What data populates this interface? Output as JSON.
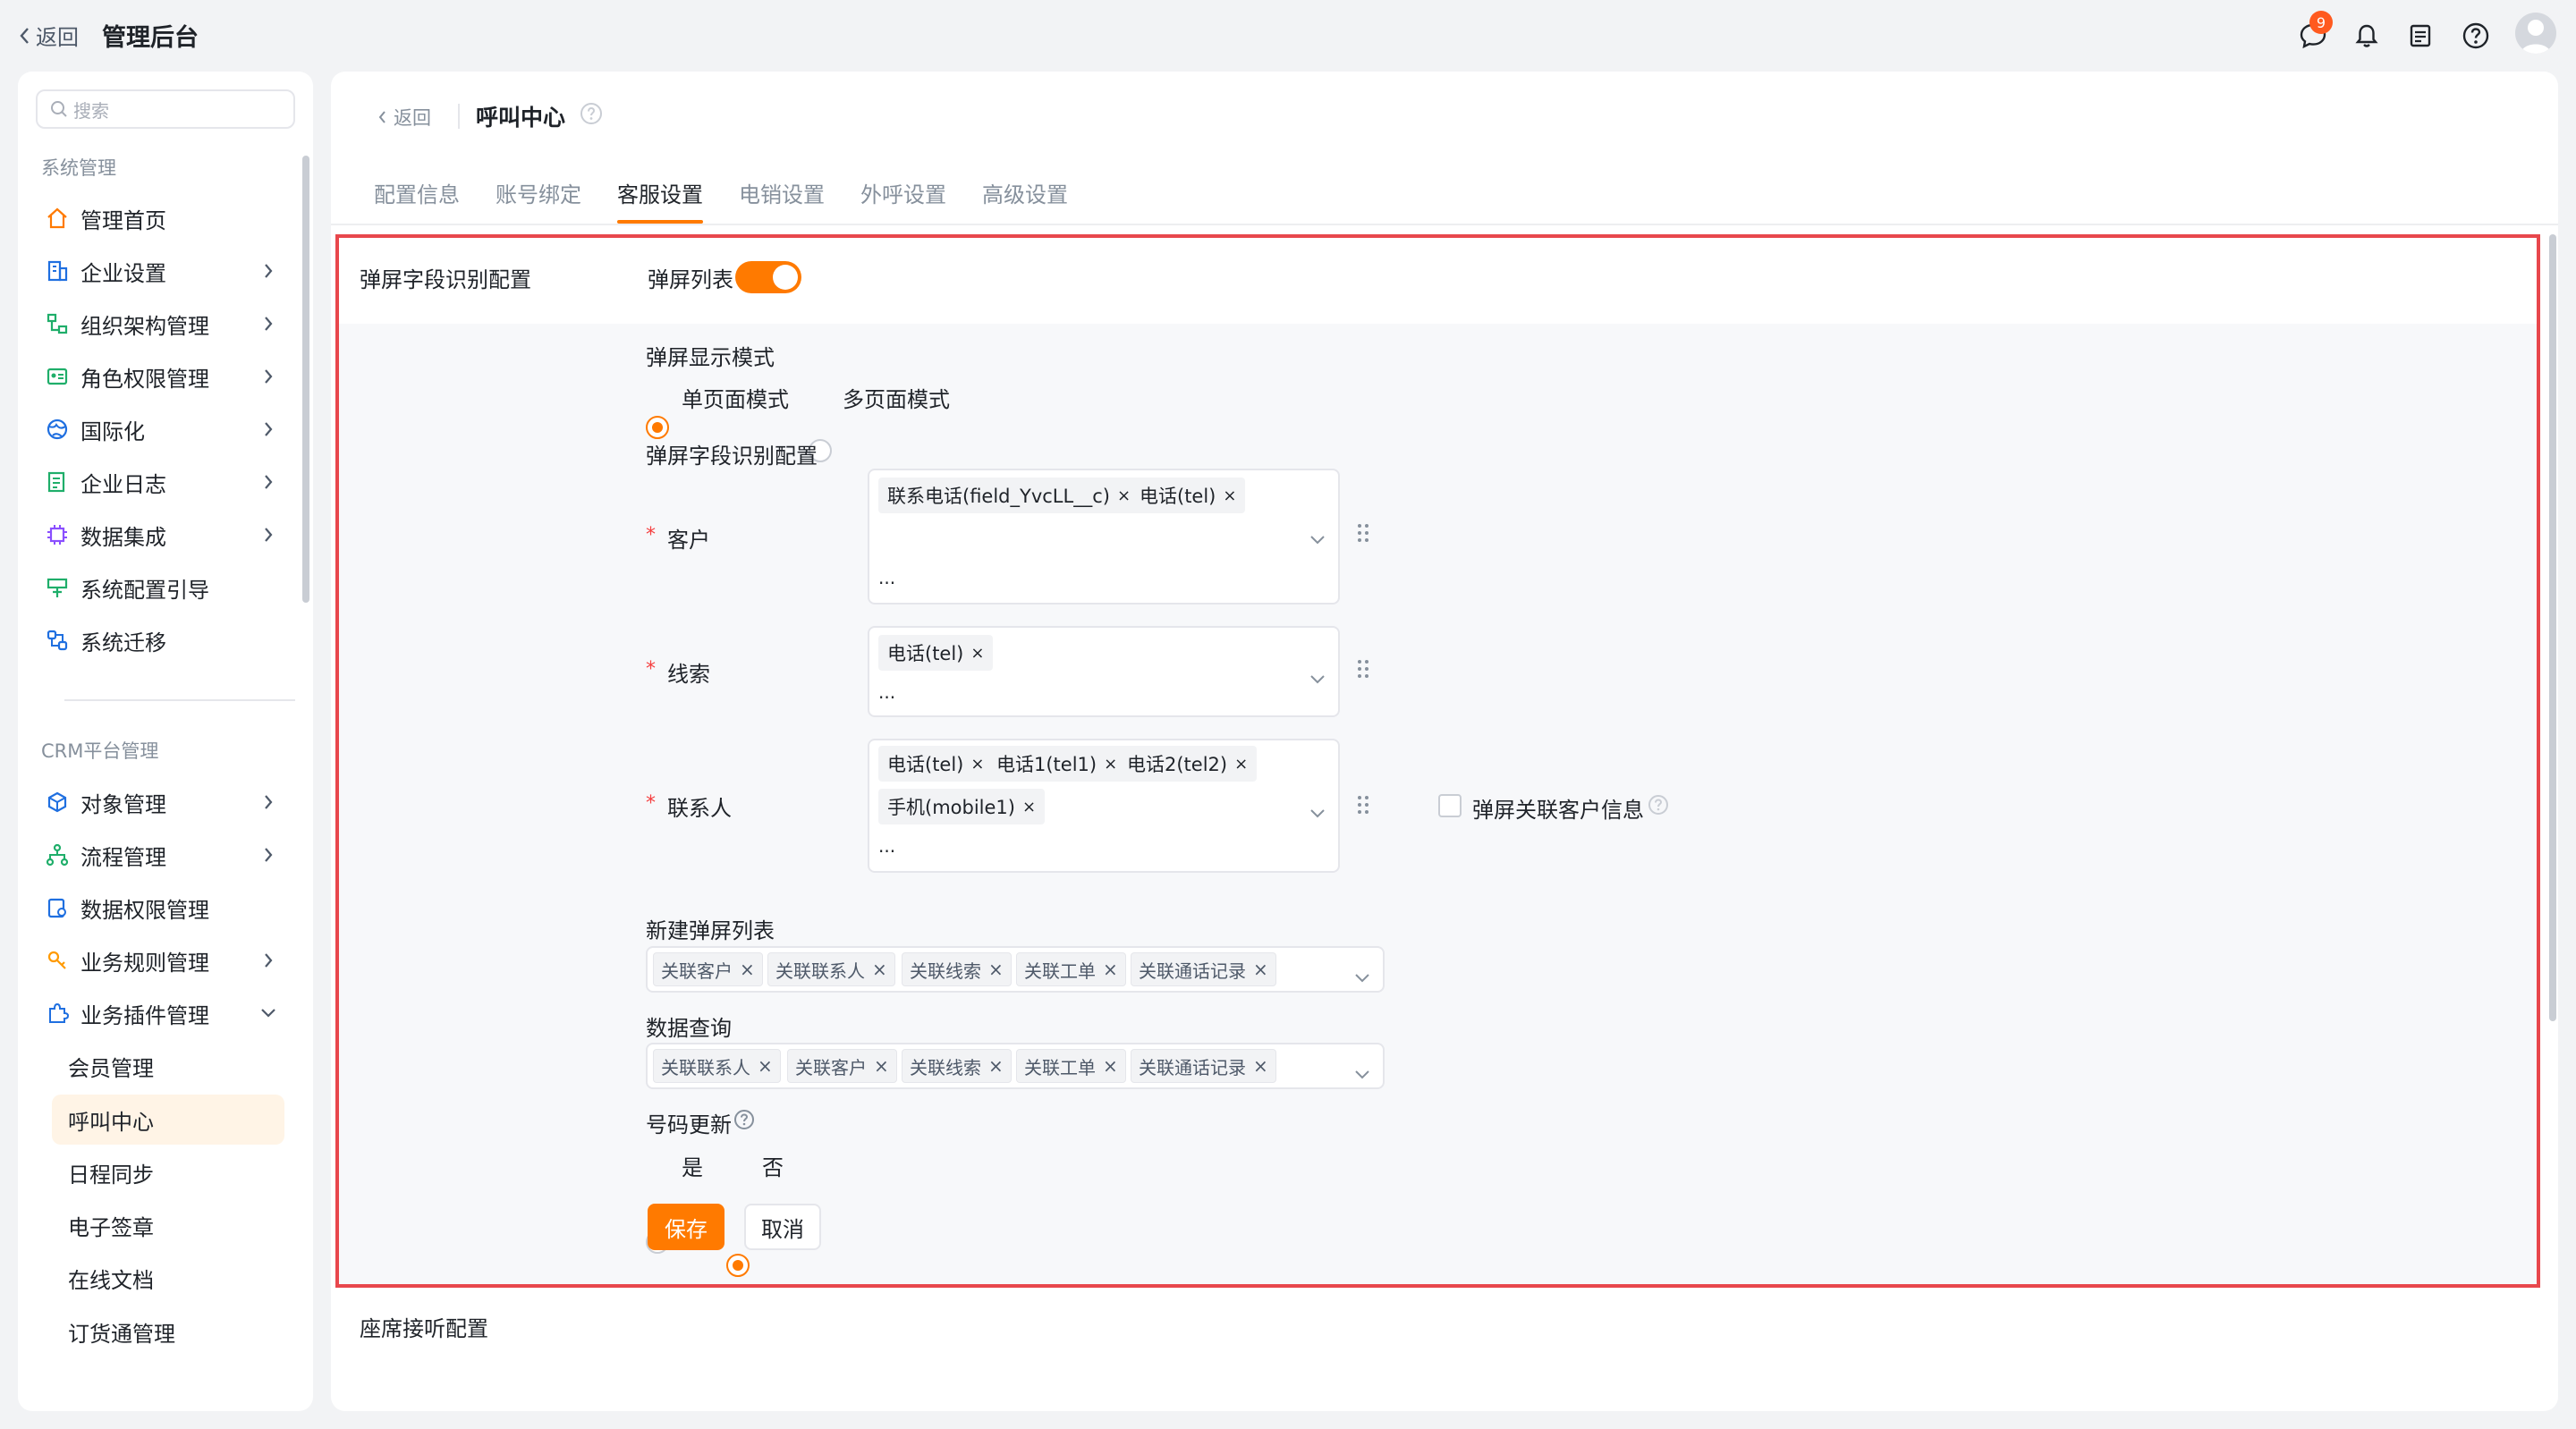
{
  "topbar": {
    "back_label": "返回",
    "title": "管理后台",
    "notification_count": "9"
  },
  "sidebar": {
    "search_placeholder": "搜索",
    "group1": "系统管理",
    "items1": [
      {
        "label": "管理首页",
        "icon": "home-icon"
      },
      {
        "label": "企业设置",
        "icon": "building-icon"
      },
      {
        "label": "组织架构管理",
        "icon": "org-icon"
      },
      {
        "label": "角色权限管理",
        "icon": "role-icon"
      },
      {
        "label": "国际化",
        "icon": "globe-icon"
      },
      {
        "label": "企业日志",
        "icon": "log-icon"
      },
      {
        "label": "数据集成",
        "icon": "chip-icon"
      },
      {
        "label": "系统配置引导",
        "icon": "guide-icon"
      },
      {
        "label": "系统迁移",
        "icon": "migrate-icon"
      }
    ],
    "group2": "CRM平台管理",
    "items2": [
      {
        "label": "对象管理",
        "icon": "object-icon"
      },
      {
        "label": "流程管理",
        "icon": "flow-icon"
      },
      {
        "label": "数据权限管理",
        "icon": "data-permission-icon"
      },
      {
        "label": "业务规则管理",
        "icon": "rule-icon"
      },
      {
        "label": "业务插件管理",
        "icon": "plugin-icon"
      }
    ],
    "subitems": [
      "会员管理",
      "呼叫中心",
      "日程同步",
      "电子签章",
      "在线文档",
      "订货通管理"
    ],
    "active_sub": "呼叫中心"
  },
  "header": {
    "back_label": "返回",
    "title": "呼叫中心"
  },
  "tabs": [
    "配置信息",
    "账号绑定",
    "客服设置",
    "电销设置",
    "外呼设置",
    "高级设置"
  ],
  "active_tab": "客服设置",
  "section1": {
    "title": "弹屏字段识别配置",
    "toggle_label": "弹屏列表",
    "toggle_on": true,
    "display_mode_label": "弹屏显示模式",
    "mode_single": "单页面模式",
    "mode_multi": "多页面模式",
    "selected_mode": "单页面模式",
    "field_config_label": "弹屏字段识别配置",
    "customer": {
      "label": "客户",
      "tags": [
        "联系电话(field_YvcLL__c)",
        "电话(tel)"
      ],
      "more": "..."
    },
    "lead": {
      "label": "线索",
      "tags": [
        "电话(tel)"
      ],
      "more": "..."
    },
    "contact": {
      "label": "联系人",
      "tags": [
        "电话(tel)",
        "电话1(tel1)",
        "电话2(tel2)",
        "手机(mobile1)"
      ],
      "more": "..."
    },
    "link_customer_info": "弹屏关联客户信息",
    "new_list_label": "新建弹屏列表",
    "new_list_tags": [
      "关联客户",
      "关联联系人",
      "关联线索",
      "关联工单",
      "关联通话记录"
    ],
    "data_query_label": "数据查询",
    "data_query_tags": [
      "关联联系人",
      "关联客户",
      "关联线索",
      "关联工单",
      "关联通话记录"
    ],
    "number_update_label": "号码更新",
    "yes": "是",
    "no": "否",
    "selected_update": "否",
    "save": "保存",
    "cancel": "取消"
  },
  "section2": {
    "title": "座席接听配置",
    "toggle_on": false
  },
  "colors": {
    "accent": "#ff7a00",
    "highlight_border": "#e8474c"
  }
}
